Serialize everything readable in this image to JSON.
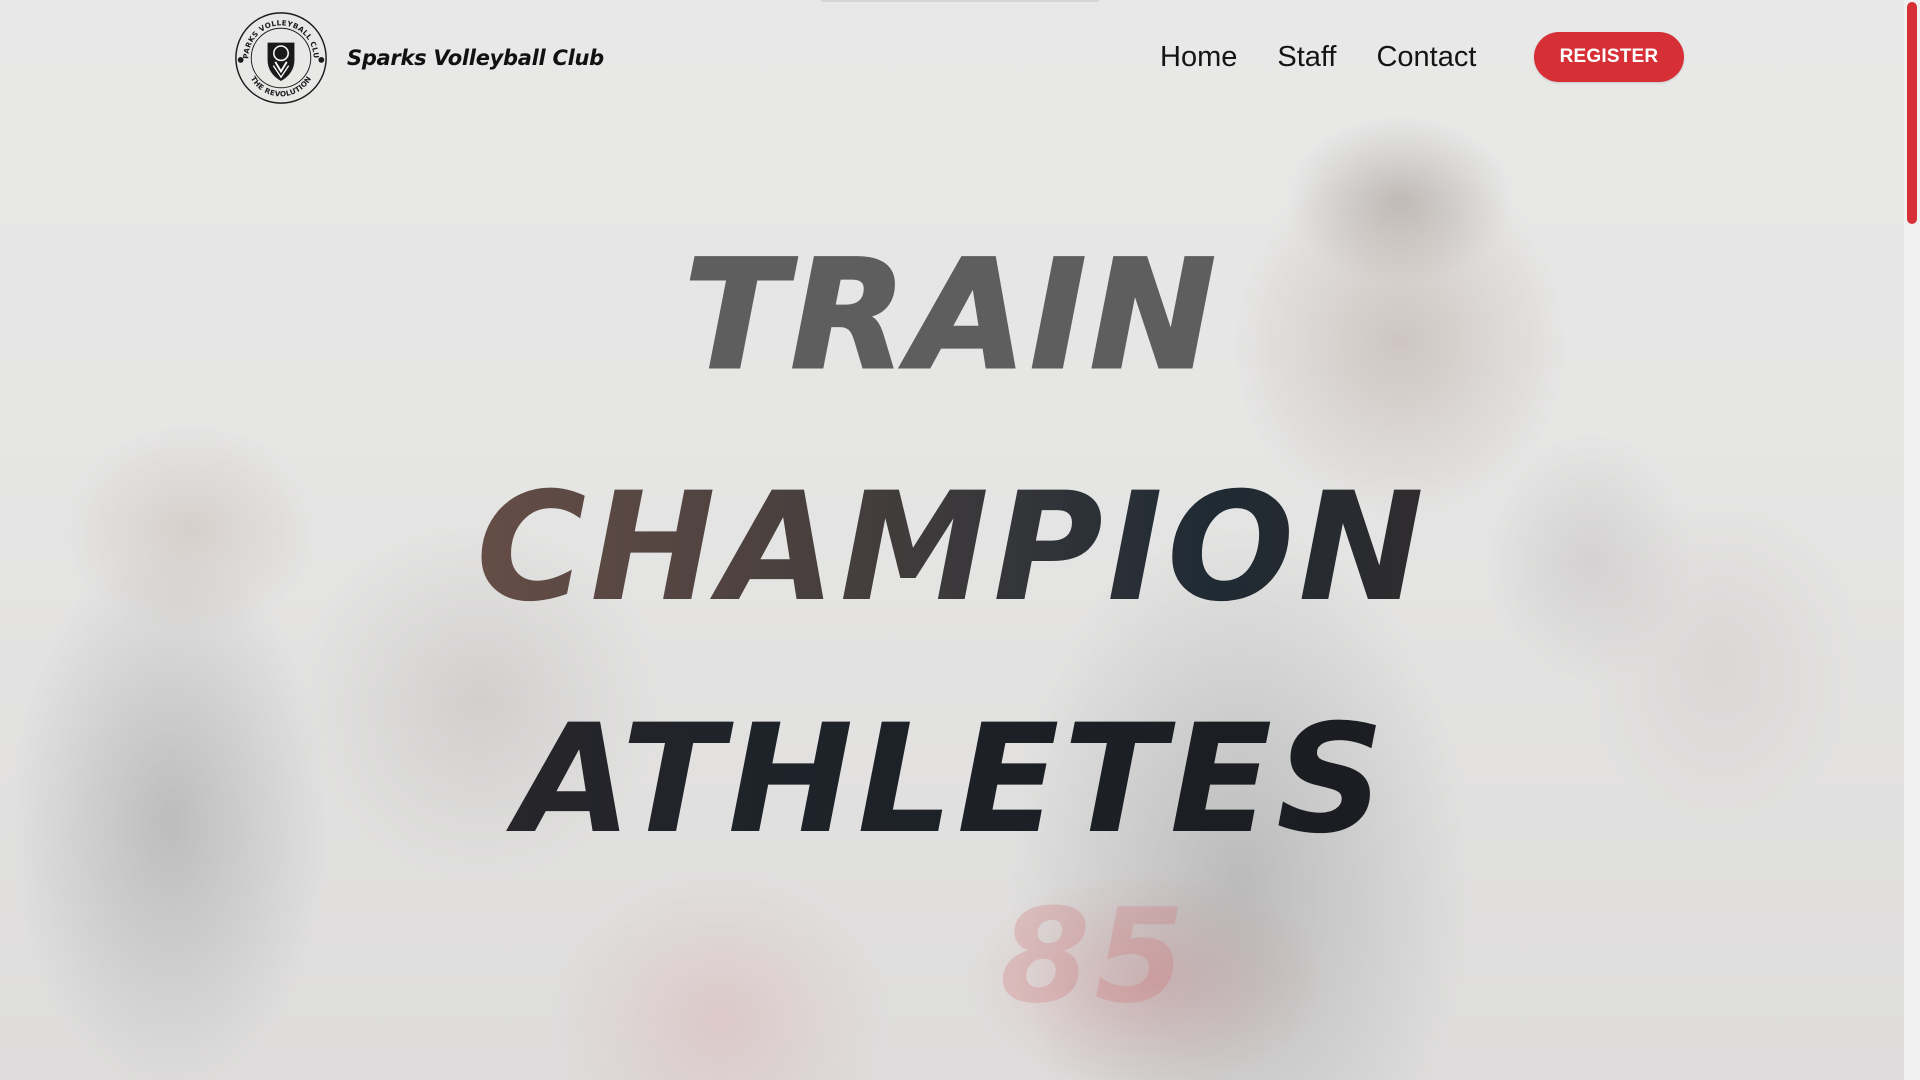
{
  "header": {
    "brand_name": "Sparks Volleyball Club",
    "logo": {
      "ring_text_top": "SPARKS VOLLEYBALL CLUB",
      "ring_text_bottom": "THE REVOLUTION",
      "icon": "shield-volleyball-logo"
    },
    "nav": {
      "home": "Home",
      "staff": "Staff",
      "contact": "Contact"
    },
    "register_label": "REGISTER"
  },
  "hero": {
    "headline": [
      "TRAIN",
      "CHAMPION",
      "ATHLETES"
    ],
    "jersey_number": "85"
  },
  "colors": {
    "accent": "#d62f36",
    "text": "#141414",
    "background": "#e6e6e4"
  }
}
